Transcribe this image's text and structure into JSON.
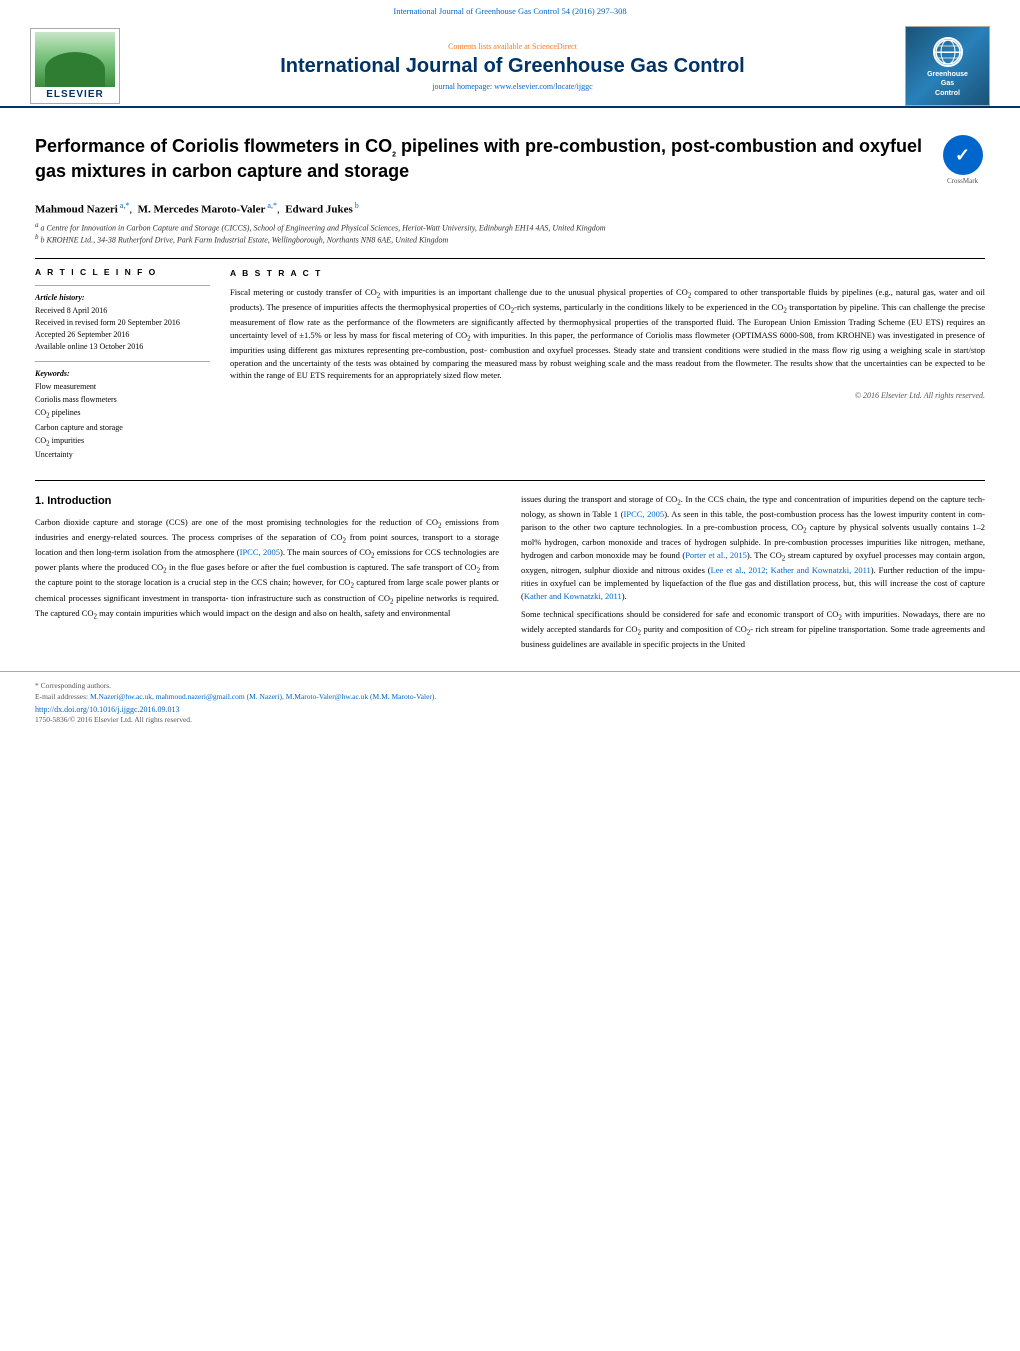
{
  "journal": {
    "top_bar": "International Journal of Greenhouse Gas Control 54 (2016) 297–308",
    "sciencedirect_text": "Contents lists available at",
    "sciencedirect_link": "ScienceDirect",
    "title": "International Journal of Greenhouse Gas Control",
    "homepage_label": "journal homepage:",
    "homepage_link": "www.elsevier.com/locate/ijggc",
    "elsevier_label": "ELSEVIER",
    "logo_title": "Greenhouse\nGas\nControl"
  },
  "article": {
    "title": "Performance of Coriolis flowmeters in CO₂ pipelines with pre-combustion, post-combustion and oxyfuel gas mixtures in carbon capture and storage",
    "title_parts": {
      "line1": "Performance of Coriolis flowmeters in CO",
      "sub1": "2",
      "line2": " pipelines with",
      "line3": "pre-combustion, post-combustion and oxyfuel gas mixtures in carbon",
      "line4": "capture and storage"
    },
    "crossmark_label": "CrossMark",
    "authors": "Mahmoud Nazeri a,*, M. Mercedes Maroto-Valer a,*, Edward Jukes b",
    "author_list": [
      {
        "name": "Mahmoud Nazeri",
        "sup": "a,*"
      },
      {
        "sep": ", "
      },
      {
        "name": "M. Mercedes Maroto-Valer",
        "sup": "a,*"
      },
      {
        "sep": ", "
      },
      {
        "name": "Edward Jukes",
        "sup": "b"
      }
    ],
    "affiliations": [
      "a Centre for Innovation in Carbon Capture and Storage (CICCS), School of Engineering and Physical Sciences, Heriot-Watt University, Edinburgh EH14 4AS, United Kingdom",
      "b KROHNE Ltd., 34-38 Rutherford Drive, Park Farm Industrial Estate, Wellingborough, Northants NN8 6AE, United Kingdom"
    ]
  },
  "article_info": {
    "heading": "A R T I C L E   I N F O",
    "history_label": "Article history:",
    "received": "Received 8 April 2016",
    "received_revised": "Received in revised form 20 September 2016",
    "accepted": "Accepted 26 September 2016",
    "available": "Available online 13 October 2016",
    "keywords_label": "Keywords:",
    "keywords": [
      "Flow measurement",
      "Coriolis mass flowmeters",
      "CO₂ pipelines",
      "Carbon capture and storage",
      "CO₂ impurities",
      "Uncertainty"
    ]
  },
  "abstract": {
    "heading": "A B S T R A C T",
    "text": "Fiscal metering or custody transfer of CO₂ with impurities is an important challenge due to the unusual physical properties of CO₂ compared to other transportable fluids by pipelines (e.g., natural gas, water and oil products). The presence of impurities affects the thermophysical properties of CO₂-rich systems, particularly in the conditions likely to be experienced in the CO₂ transportation by pipeline. This can challenge the precise measurement of flow rate as the performance of the flowmeters are significantly affected by thermophysical properties of the transported fluid. The European Union Emission Trading Scheme (EU ETS) requires an uncertainty level of ±1.5% or less by mass for fiscal metering of CO₂ with impurities. In this paper, the performance of Coriolis mass flowmeter (OPTIMASS 6000-S08, from KROHNE) was investigated in presence of impurities using different gas mixtures representing pre-combustion, post-combustion and oxyfuel processes. Steady state and transient conditions were studied in the mass flow rig using a weighing scale in start/stop operation and the uncertainty of the tests was obtained by comparing the measured mass by robust weighing scale and the mass readout from the flowmeter. The results show that the uncertainties can be expected to be within the range of EU ETS requirements for an appropriately sized flow meter.",
    "copyright": "© 2016 Elsevier Ltd. All rights reserved."
  },
  "introduction": {
    "section_num": "1.",
    "section_title": "Introduction",
    "col1_paragraphs": [
      "Carbon dioxide capture and storage (CCS) are one of the most promising technologies for the reduction of CO₂ emissions from industries and energy-related sources. The process comprises of the separation of CO₂ from point sources, transport to a storage location and then long-term isolation from the atmosphere (IPCC, 2005). The main sources of CO₂ emissions for CCS technologies are power plants where the produced CO₂ in the flue gases before or after the fuel combustion is captured. The safe transport of CO₂ from the capture point to the storage location is a crucial step in the CCS chain; however, for CO₂ captured from large scale power plants or chemical processes significant investment in transportation infrastructure such as construction of CO₂ pipeline networks is required. The captured CO₂ may contain impurities which would impact on the design and also on health, safety and environmental"
    ],
    "col2_paragraphs": [
      "issues during the transport and storage of CO₂. In the CCS chain, the type and concentration of impurities depend on the capture technology, as shown in Table 1 (IPCC, 2005). As seen in this table, the post-combustion process has the lowest impurity content in comparison to the other two capture technologies. In a pre-combustion process, CO₂ capture by physical solvents usually contains 1–2 mol% hydrogen, carbon monoxide and traces of hydrogen sulphide. In pre-combustion processes impurities like nitrogen, methane, hydrogen and carbon monoxide may be found (Porter et al., 2015). The CO₂ stream captured by oxyfuel processes may contain argon, oxygen, nitrogen, sulphur dioxide and nitrous oxides (Lee et al., 2012; Kather and Kownatzki, 2011). Further reduction of the impurities in oxyfuel can be implemented by liquefaction of the flue gas and distillation process, but, this will increase the cost of capture (Kather and Kownatzki, 2011).",
      "Some technical specifications should be considered for safe and economic transport of CO₂ with impurities. Nowadays, there are no widely accepted standards for CO₂ purity and composition of CO₂-rich stream for pipeline transportation. Some trade agreements and business guidelines are available in specific projects in the United"
    ]
  },
  "footer": {
    "footnote_star": "* Corresponding authors.",
    "email_label": "E-mail addresses:",
    "emails": "M.Nazeri@hw.ac.uk, mahmoud.nazeri@gmail.com (M. Nazeri), M.Maroto-Valer@hw.ac.uk (M.M. Maroto-Valer).",
    "doi": "http://dx.doi.org/10.1016/j.ijggc.2016.09.013",
    "issn": "1750-5836/© 2016 Elsevier Ltd. All rights reserved."
  }
}
